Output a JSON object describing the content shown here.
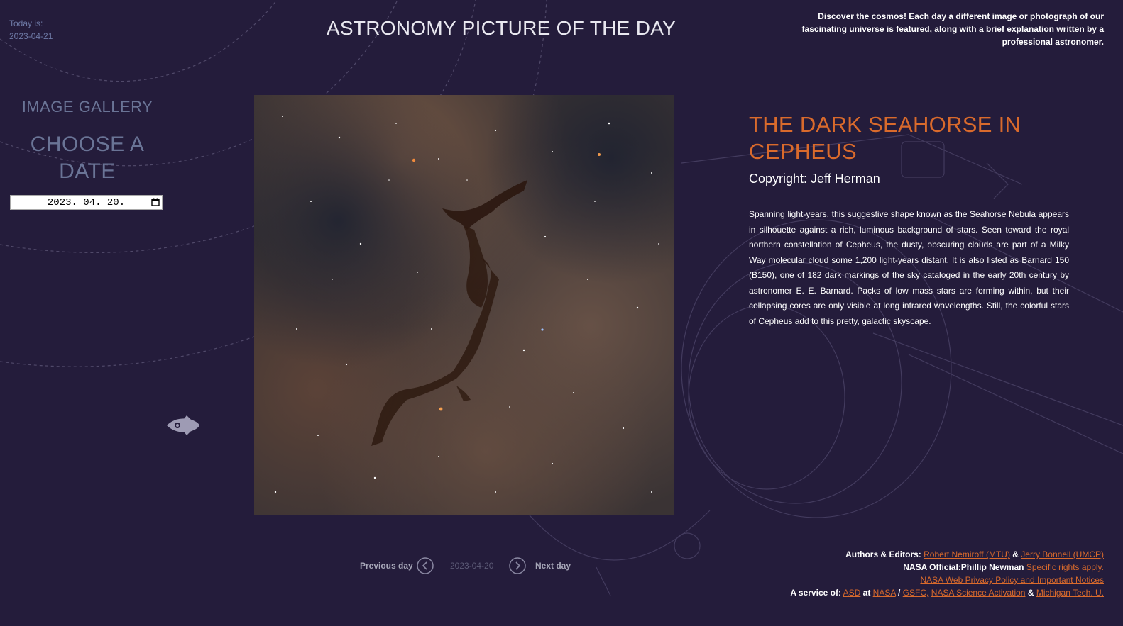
{
  "today": {
    "label": "Today is:",
    "date": "2023-04-21"
  },
  "header": {
    "title": "ASTRONOMY PICTURE OF THE DAY",
    "intro": "Discover the cosmos! Each day a different image or photograph of our fascinating universe is featured, along with a brief explanation written by a professional astronomer."
  },
  "sidebar": {
    "gallery_title": "IMAGE GALLERY",
    "choose_title": "CHOOSE A DATE",
    "date_value": "2023. 04. 20."
  },
  "picture": {
    "title": "THE DARK SEAHORSE IN CEPHEUS",
    "copyright": "Copyright: Jeff Herman",
    "explanation": "Spanning light-years, this suggestive shape known as the Seahorse Nebula appears in silhouette against a rich, luminous background of stars. Seen toward the royal northern constellation of Cepheus, the dusty, obscuring clouds are part of a Milky Way molecular cloud some 1,200 light-years distant. It is also listed as Barnard 150 (B150), one of 182 dark markings of the sky cataloged in the early 20th century by astronomer E. E. Barnard. Packs of low mass stars are forming within, but their collapsing cores are only visible at long infrared wavelengths. Still, the colorful stars of Cepheus add to this pretty, galactic skyscape."
  },
  "nav": {
    "prev_label": "Previous day",
    "current_date": "2023-04-20",
    "next_label": "Next day"
  },
  "footer": {
    "authors_label": "Authors & Editors:",
    "author1": "Robert Nemiroff (MTU)",
    "amp1": "&",
    "author2": "Jerry Bonnell (UMCP)",
    "official_label": "NASA Official:",
    "official_name": "Phillip Newman",
    "rights_link": "Specific rights apply.",
    "privacy_link": "NASA Web Privacy Policy and Important Notices",
    "service_label": "A service of:",
    "asd_link": "ASD",
    "at_text": "at",
    "nasa_link": "NASA",
    "slash_text": "/",
    "gsfc_link": "GSFC,",
    "activation_link": "NASA Science Activation",
    "amp2": "&",
    "mtu_link": "Michigan Tech. U."
  },
  "colors": {
    "background": "#241c3b",
    "accent": "#d96a2c",
    "muted": "#6a7496"
  },
  "icons": [
    "rocket-icon",
    "calendar-icon",
    "chevron-left-icon",
    "chevron-right-icon"
  ]
}
